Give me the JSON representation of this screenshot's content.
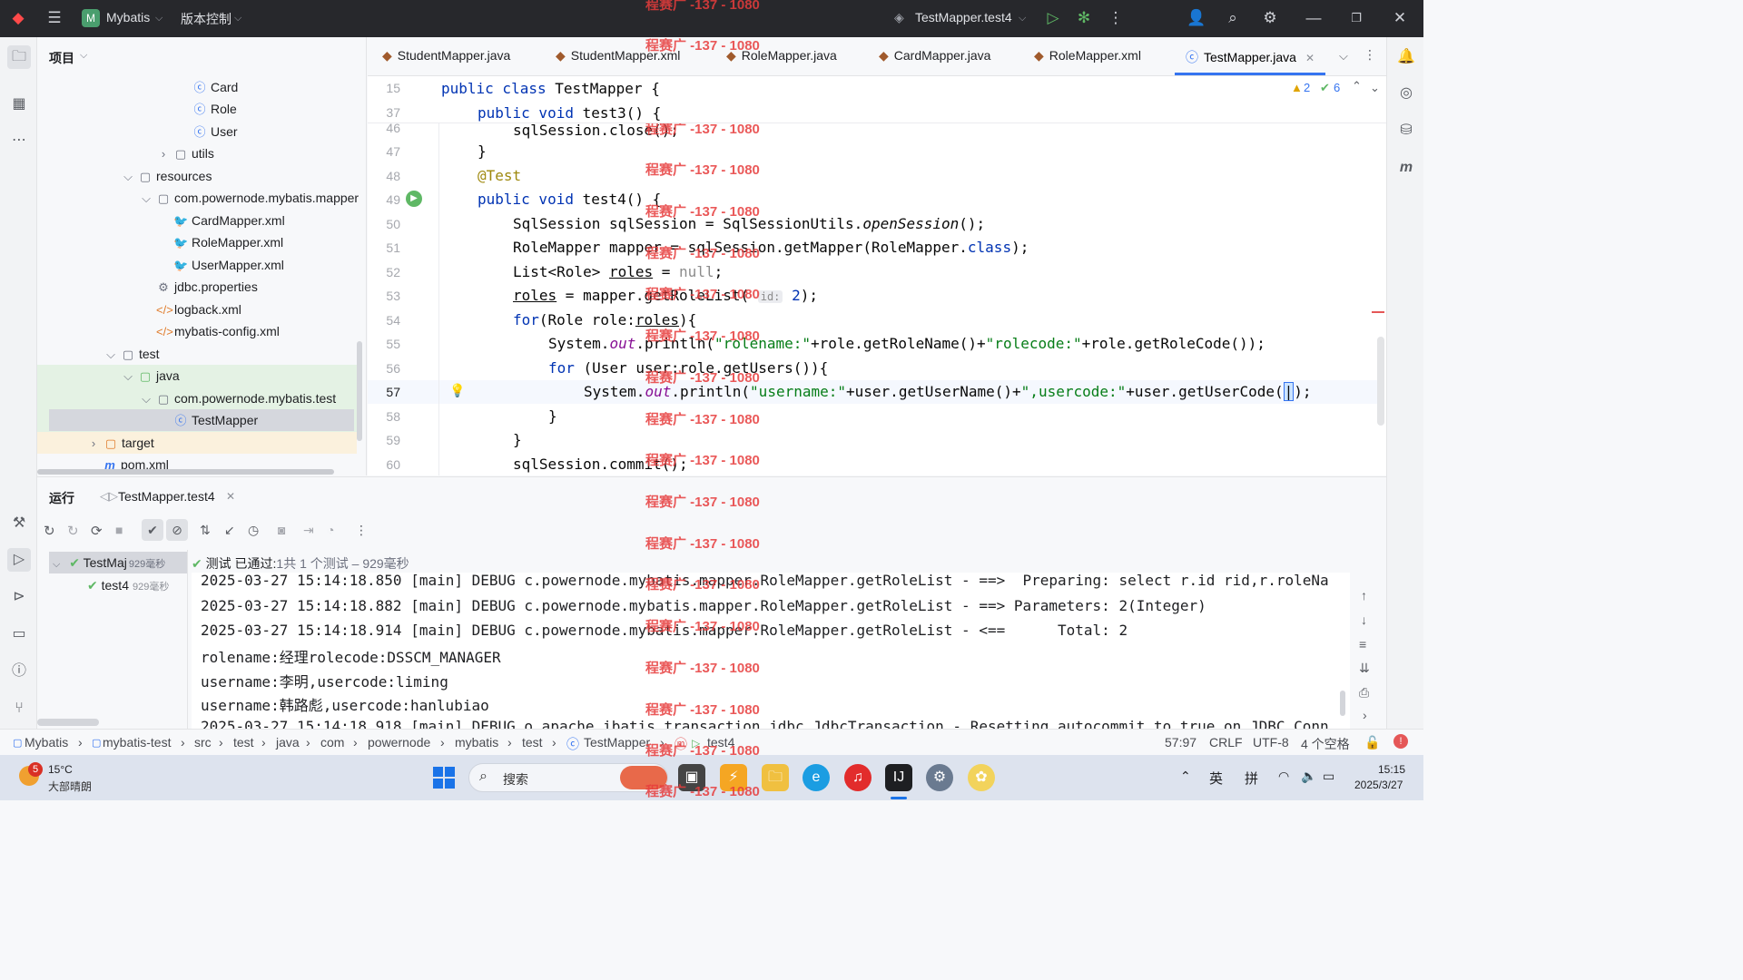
{
  "titlebar": {
    "project_initial": "M",
    "project_name": "Mybatis",
    "vcs_menu": "版本控制",
    "run_config": "TestMapper.test4"
  },
  "project_panel": {
    "title": "项目",
    "tree": [
      {
        "label": "Card",
        "icon": "class-icon"
      },
      {
        "label": "Role",
        "icon": "class-icon"
      },
      {
        "label": "User",
        "icon": "class-icon"
      },
      {
        "label": "utils",
        "icon": "package-icon"
      },
      {
        "label": "resources",
        "icon": "folder-icon"
      },
      {
        "label": "com.powernode.mybatis.mapper",
        "icon": "folder-icon"
      },
      {
        "label": "CardMapper.xml",
        "icon": "mybatis-xml-icon"
      },
      {
        "label": "RoleMapper.xml",
        "icon": "mybatis-xml-icon"
      },
      {
        "label": "UserMapper.xml",
        "icon": "mybatis-xml-icon"
      },
      {
        "label": "jdbc.properties",
        "icon": "properties-icon"
      },
      {
        "label": "logback.xml",
        "icon": "xml-icon"
      },
      {
        "label": "mybatis-config.xml",
        "icon": "xml-icon"
      },
      {
        "label": "test",
        "icon": "folder-icon"
      },
      {
        "label": "java",
        "icon": "test-root-icon"
      },
      {
        "label": "com.powernode.mybatis.test",
        "icon": "package-icon"
      },
      {
        "label": "TestMapper",
        "icon": "test-class-icon"
      },
      {
        "label": "target",
        "icon": "excluded-folder-icon"
      },
      {
        "label": "pom.xml",
        "icon": "maven-icon"
      }
    ]
  },
  "tabs": [
    {
      "label": "StudentMapper.java"
    },
    {
      "label": "StudentMapper.xml"
    },
    {
      "label": "RoleMapper.java"
    },
    {
      "label": "CardMapper.java"
    },
    {
      "label": "RoleMapper.xml"
    },
    {
      "label": "TestMapper.java",
      "active": true
    }
  ],
  "editor": {
    "warnings": "2",
    "checks": "6",
    "line_numbers": [
      "15",
      "37",
      "46",
      "47",
      "48",
      "49",
      "50",
      "51",
      "52",
      "53",
      "54",
      "55",
      "56",
      "57",
      "58",
      "59",
      "60"
    ],
    "hint_param": "id:",
    "hint_value": "2"
  },
  "run_panel": {
    "title": "运行",
    "config_tab": "TestMapper.test4",
    "tree": [
      {
        "label": "TestMaj",
        "time": "929毫秒"
      },
      {
        "label": "test4",
        "time": "929毫秒"
      }
    ],
    "summary_prefix": "测试",
    "summary_status": "已通过:",
    "summary_count": "1共 1 个测试 – 929毫秒",
    "console": [
      "2025-03-27 15:14:18.850 [main] DEBUG c.powernode.mybatis.mapper.RoleMapper.getRoleList - ==>  Preparing: select r.id rid,r.roleNa",
      "2025-03-27 15:14:18.882 [main] DEBUG c.powernode.mybatis.mapper.RoleMapper.getRoleList - ==> Parameters: 2(Integer)",
      "2025-03-27 15:14:18.914 [main] DEBUG c.powernode.mybatis.mapper.RoleMapper.getRoleList - <==      Total: 2",
      "rolename:经理rolecode:DSSCM_MANAGER",
      "username:李明,usercode:liming",
      "username:韩路彪,usercode:hanlubiao",
      "2025-03-27 15:14:18.918 [main] DEBUG o.apache.ibatis.transaction.jdbc.JdbcTransaction - Resetting autocommit to true on JDBC Conn"
    ]
  },
  "statusbar": {
    "breadcrumbs": [
      "Mybatis",
      "mybatis-test",
      "src",
      "test",
      "java",
      "com",
      "powernode",
      "mybatis",
      "test",
      "TestMapper",
      "test4"
    ],
    "position": "57:97",
    "line_sep": "CRLF",
    "encoding": "UTF-8",
    "indent": "4 个空格"
  },
  "taskbar": {
    "weather_badge": "5",
    "temperature": "15°C",
    "weather": "大部晴朗",
    "search_placeholder": "搜索",
    "ime_lang": "英",
    "ime_mode": "拼",
    "time": "15:15",
    "date": "2025/3/27"
  },
  "watermark": "程赛广 -137 - 1080"
}
